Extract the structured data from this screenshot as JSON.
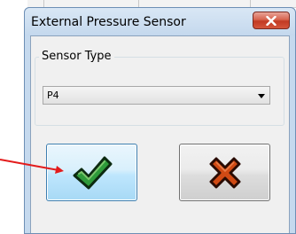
{
  "window": {
    "title": "External Pressure Sensor"
  },
  "group": {
    "label": "Sensor Type"
  },
  "sensor_type_select": {
    "selected": "P4"
  },
  "icons": {
    "close": "close-icon",
    "dropdown": "chevron-down-icon",
    "ok": "checkmark-icon",
    "cancel": "cross-icon"
  },
  "colors": {
    "ok_check": "#2e9a3a",
    "cancel_cross": "#d04a14",
    "close_button": "#c7432c",
    "annotation_arrow": "#e31b1b"
  }
}
